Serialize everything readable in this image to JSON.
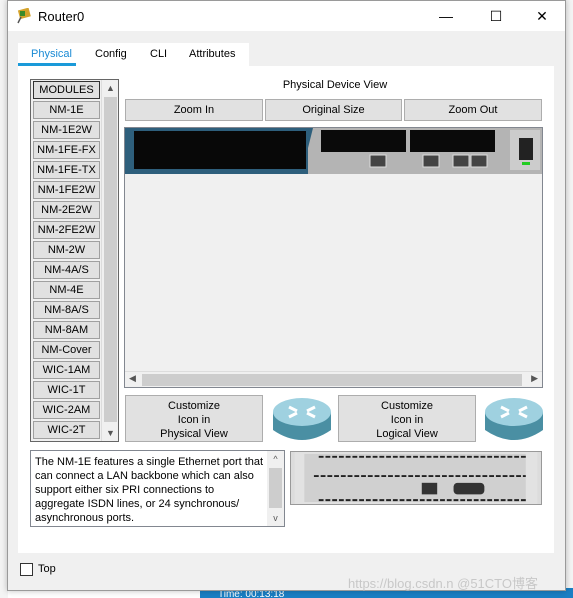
{
  "window": {
    "title": "Router0",
    "minimize": "—",
    "maximize": "☐",
    "close": "✕"
  },
  "tabs": [
    {
      "label": "Physical",
      "active": true
    },
    {
      "label": "Config"
    },
    {
      "label": "CLI"
    },
    {
      "label": "Attributes"
    }
  ],
  "modules": {
    "header": "MODULES",
    "items": [
      "NM-1E",
      "NM-1E2W",
      "NM-1FE-FX",
      "NM-1FE-TX",
      "NM-1FE2W",
      "NM-2E2W",
      "NM-2FE2W",
      "NM-2W",
      "NM-4A/S",
      "NM-4E",
      "NM-8A/S",
      "NM-8AM",
      "NM-Cover",
      "WIC-1AM",
      "WIC-1T",
      "WIC-2AM",
      "WIC-2T"
    ]
  },
  "physical_view": {
    "label": "Physical Device View",
    "zoom_in": "Zoom In",
    "original_size": "Original Size",
    "zoom_out": "Zoom Out"
  },
  "customize": {
    "physical": "Customize\nIcon in\nPhysical View",
    "logical": "Customize\nIcon in\nLogical View"
  },
  "description": "The NM-1E features a single Ethernet port that can connect a LAN backbone which can also support either six PRI connections to aggregate ISDN lines, or 24 synchronous/ asynchronous ports.",
  "top_checkbox": {
    "label": "Top",
    "checked": false
  },
  "watermark": "https://blog.csdn.n @51CTO博客",
  "background": {
    "time": "Time: 00:13:18"
  },
  "colors": {
    "accent": "#1a9ad9",
    "device_slot": "#2e5f7c"
  }
}
